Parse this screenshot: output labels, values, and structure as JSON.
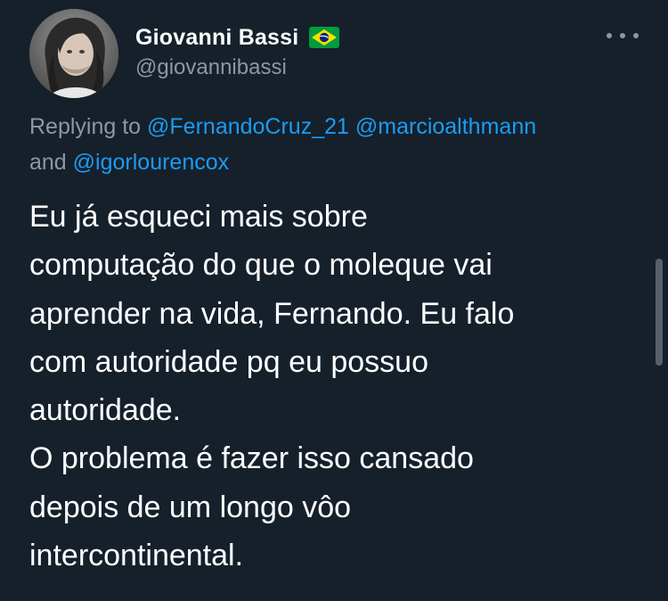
{
  "tweet": {
    "author": {
      "display_name": "Giovanni Bassi",
      "handle": "@giovannibassi",
      "flag_emoji_icon": "brazil-flag-icon",
      "avatar_icon": "avatar-photo"
    },
    "replying_to": {
      "prefix": "Replying to",
      "mentions": [
        "@FernandoCruz_21",
        "@marcioalthmann",
        "@igorlourencox"
      ],
      "conjunction": "and"
    },
    "text_lines": [
      "Eu já esqueci mais sobre",
      "computação do que o moleque vai",
      "aprender na vida, Fernando. Eu falo",
      "com autoridade pq eu possuo",
      "autoridade.",
      "O problema é fazer isso cansado",
      "depois de um longo vôo",
      "intercontinental."
    ],
    "more_icon": "more-options-icon"
  },
  "colors": {
    "background": "#15202b",
    "text": "#ffffff",
    "secondary_text": "#8b98a5",
    "link": "#1d9bf0"
  }
}
